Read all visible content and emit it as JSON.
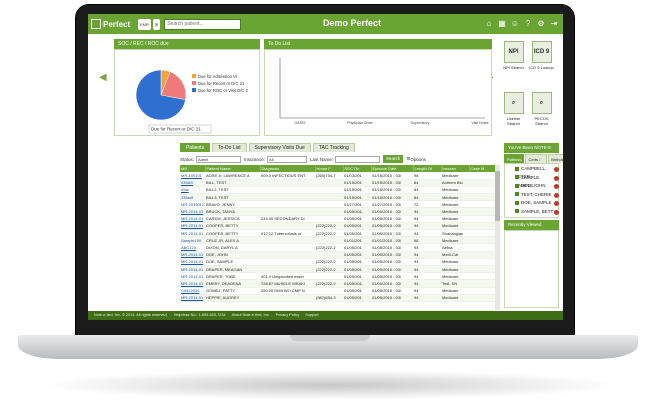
{
  "app": {
    "logo": "Perfect",
    "title": "Demo Perfect",
    "search_placeholder": "Search patient...",
    "topbar_btn": "EMR"
  },
  "soc_panel": {
    "title": "SOC / REC / ROC due",
    "legend": [
      {
        "label": "Due for Admission Vi",
        "color": "#f4a23a"
      },
      {
        "label": "Due for Recert or D/C 21",
        "color": "#f07a7a"
      },
      {
        "label": "Due for ROC or Visit D/C 2",
        "color": "#2e6fd0"
      }
    ],
    "tooltip": "Due for Recert or D/C 21",
    "pie": {
      "orange": 0.06,
      "red": 0.22,
      "blue": 0.72
    }
  },
  "todo_panel": {
    "title": "To Do List",
    "ticks": [
      "OASIS",
      "Physician Order",
      "Supervisory",
      "Visit Notes"
    ]
  },
  "quick_links": [
    {
      "label": "NPI Search",
      "icon": "NPI"
    },
    {
      "label": "ICD 9 Lookup",
      "icon": "ICD 9"
    },
    {
      "label": "License Search",
      "icon": "⌕"
    },
    {
      "label": "PECOS Search",
      "icon": "⌕"
    }
  ],
  "tabs": [
    "Patients",
    "To-Do List",
    "Supervisory Visits Due",
    "TAC Tracking"
  ],
  "filters": {
    "status_label": "Status:",
    "status_value": "Admit",
    "insurance_label": "Insurance:",
    "insurance_value": "All",
    "lastname_label": "Last Name:",
    "search_btn": "Search",
    "options_btn": "Options"
  },
  "grid": {
    "headers": [
      "MR",
      "Patient Name",
      "Diagnosis",
      "Home F",
      "SOC Dc",
      "Episode Date",
      "Length Of",
      "Insuran",
      "Case M"
    ],
    "rows": [
      [
        "MR-100101",
        "ACRE Jr, LAWRENCE A",
        "009.0 INFECTIOUS ENT",
        "(265)754-7",
        "01/03/201",
        "01/15/2015 - 03/",
        "98",
        "Medicare",
        ""
      ],
      [
        "435AS",
        "BILL, TEST",
        "",
        "",
        "01/15/201",
        "01/15/2015 - 03/",
        "84",
        "Anthem Blu",
        ""
      ],
      [
        "45ai",
        "BILL2, TEST",
        "",
        "",
        "01/15/201",
        "01/15/2015 - 03/",
        "84",
        "Medicare",
        ""
      ],
      [
        "436sdf",
        "BILL3, TEST",
        "",
        "",
        "01/15/201",
        "01/15/2015 - 03/",
        "84",
        "Medicare",
        ""
      ],
      [
        "MR-20150127",
        "BRAVO, JENNY",
        "",
        "",
        "01/27/201",
        "01/27/2015 - 03/",
        "72",
        "Medicare",
        ""
      ],
      [
        "MR-2014-01",
        "BRUCK, TANYA",
        "",
        "",
        "01/05/201",
        "01/05/2015 - 03/",
        "94",
        "Medicare",
        ""
      ],
      [
        "MR-2014-01",
        "CAREW, JESSICA",
        "249.00 SECONDARY DI",
        "",
        "01/05/201",
        "01/05/2015 - 03/",
        "94",
        "Medicare",
        ""
      ],
      [
        "MR-2014-01",
        "COOPER, BETTY",
        "",
        "(222)222-2",
        "01/05/201",
        "01/05/2015 - 03/",
        "94",
        "Medicare",
        ""
      ],
      [
        "MR-2014-01",
        "COOPER, BETTY",
        "012.12 Tuberculosis of",
        "(222)222-2",
        "01/05/201",
        "01/05/2015 - 03/",
        "94",
        "Shahangian",
        ""
      ],
      [
        "Sample100",
        "CRUZ JR, ALEX A",
        "",
        "",
        "01/01/201",
        "01/01/2015 - 03/",
        "98",
        "Medicare",
        ""
      ],
      [
        "ABC123",
        "DIXON, DARYL A",
        "",
        "(222)222-2",
        "01/05/201",
        "01/05/2015 - 03/",
        "94",
        "Aetna",
        ""
      ],
      [
        "MR-2014-01",
        "DOE, JOHN",
        "",
        "",
        "01/05/201",
        "01/05/2015 - 03/",
        "94",
        "Medi-Cal",
        ""
      ],
      [
        "MR-2014-01",
        "DOE, SAMPLE",
        "",
        "(222)222-2",
        "01/05/201",
        "01/05/2015 - 03/",
        "94",
        "Medicare",
        ""
      ],
      [
        "MR-2014-01",
        "DRAPER, MEAGAN",
        "",
        "(222)222-2",
        "01/05/201",
        "01/05/2015 - 03/",
        "94",
        "Medicare",
        ""
      ],
      [
        "MR-2014-01",
        "DRAPER, TOBE",
        "401.9 Unspecified esser",
        "",
        "01/05/201",
        "01/05/2015 - 03/",
        "94",
        "Medicare",
        ""
      ],
      [
        "MR-2014-01",
        "EMERY, DEADENA",
        "728.87 MUSCLE WEAKI",
        "(222)222-2",
        "01/05/201",
        "01/05/2015 - 03/",
        "94",
        "Test, SN",
        ""
      ],
      [
        "C0522015",
        "GOMEZ, PATTY",
        "250.00 DMII WO CMP N",
        "",
        "01/05/201",
        "01/05/2015 - 03/",
        "94",
        "Medicare",
        ""
      ],
      [
        "MR-2014-01",
        "HEPPIE, AUDREY",
        "",
        "(987)654-3",
        "01/05/201",
        "01/05/2015 - 03/",
        "94",
        "Medicare",
        ""
      ]
    ],
    "footer_total": "Total Active:51",
    "footer_avg_label": "Average",
    "footer_avg_value": "58.76"
  },
  "right_panel": {
    "title": "You've Been NOTE-E FIED!",
    "tabs": [
      "Patients",
      "Certs / Licenses",
      "Birthdays"
    ],
    "patients": [
      "CAMPBELL, PETER",
      "SAMPLE, SAMPLE",
      "DOE, JOHN",
      "TEST, CHERIE",
      "DOE, SAMPLE",
      "SAMPLE, BETTY"
    ],
    "recent_title": "Recently Viewed"
  },
  "footer": {
    "copyright": "Note-e-fied, Inc. © 2014. All rights reserved.",
    "helpdesk": "Helpdesk No.: 1-855-825-7234",
    "links": [
      "About Note-e-fied, Inc.",
      "Privacy Policy",
      "Support"
    ]
  }
}
